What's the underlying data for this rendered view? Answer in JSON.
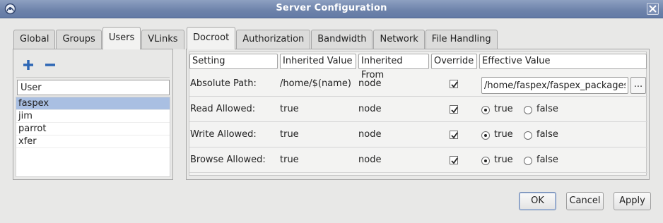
{
  "window": {
    "title": "Server Configuration"
  },
  "left_tabs": [
    "Global",
    "Groups",
    "Users",
    "VLinks"
  ],
  "left_active_tab": "Users",
  "users": {
    "filter_value": "User",
    "items": [
      "faspex",
      "jim",
      "parrot",
      "xfer"
    ],
    "selected": "faspex"
  },
  "right_tabs": [
    "Docroot",
    "Authorization",
    "Bandwidth",
    "Network",
    "File Handling"
  ],
  "right_active_tab": "Docroot",
  "table": {
    "headers": [
      "Setting",
      "Inherited Value",
      "Inherited From",
      "Override",
      "Effective Value"
    ],
    "rows": [
      {
        "setting": "Absolute Path:",
        "inherited_value": "/home/$(name)",
        "inherited_from": "node",
        "override": true,
        "effective_value": "/home/faspex/faspex_packages",
        "browse_label": "..."
      },
      {
        "setting": "Read Allowed:",
        "inherited_value": "true",
        "inherited_from": "node",
        "override": true,
        "option_true": "true",
        "option_false": "false",
        "selected": "true"
      },
      {
        "setting": "Write Allowed:",
        "inherited_value": "true",
        "inherited_from": "node",
        "override": true,
        "option_true": "true",
        "option_false": "false",
        "selected": "true"
      },
      {
        "setting": "Browse Allowed:",
        "inherited_value": "true",
        "inherited_from": "node",
        "override": true,
        "option_true": "true",
        "option_false": "false",
        "selected": "true"
      }
    ]
  },
  "buttons": {
    "ok": "OK",
    "cancel": "Cancel",
    "apply": "Apply"
  },
  "colors": {
    "titlebar": "#6d82aa",
    "selection": "#a9bfe2",
    "add_icon": "#2d67b5"
  }
}
